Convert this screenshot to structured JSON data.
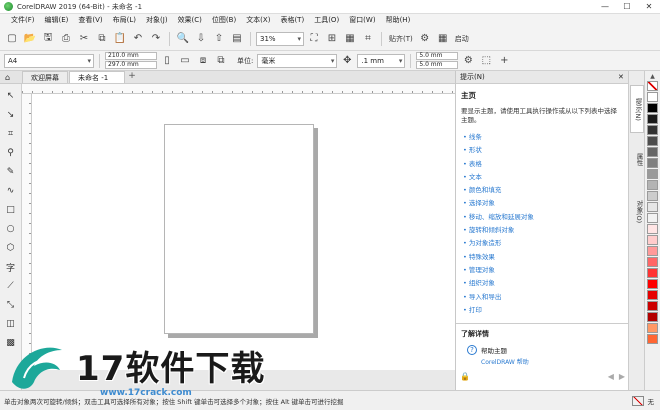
{
  "window": {
    "title": "CorelDRAW 2019 (64-Bit) - 未命名 -1"
  },
  "menu": [
    "文件(F)",
    "编辑(E)",
    "查看(V)",
    "布局(L)",
    "对象(J)",
    "效果(C)",
    "位图(B)",
    "文本(X)",
    "表格(T)",
    "工具(O)",
    "窗口(W)",
    "帮助(H)"
  ],
  "toolbar": {
    "zoom": "31%",
    "snap_label": "贴齐(T)",
    "launch_label": "启动"
  },
  "propbar": {
    "page_size": "A4",
    "width": "210.0 mm",
    "height": "297.0 mm",
    "unit_label": "单位:",
    "unit": "毫米",
    "nudge": ".1 mm",
    "dup_x": "5.0 mm",
    "dup_y": "5.0 mm"
  },
  "tabs": [
    "欢迎屏幕",
    "未命名 -1"
  ],
  "hints": {
    "header": "提示(N)",
    "section": "主页",
    "description": "要显示主题，请使用工具执行操作或从以下列表中选择主题。",
    "links": [
      "线条",
      "形状",
      "表格",
      "文本",
      "颜色和填充",
      "选择对象",
      "移动、缩放和延展对象",
      "旋转和倾斜对象",
      "为对象造形",
      "特殊效果",
      "管理对象",
      "组织对象",
      "导入和导出",
      "打印"
    ],
    "learn_more_title": "了解详情",
    "help_topic_title": "帮助主题",
    "help_topic_link": "CorelDRAW 帮助"
  },
  "side_tabs": [
    "提示(N)",
    "属性",
    "对象(O)"
  ],
  "status": {
    "text": "单击对象两次可旋转/倾斜；双击工具可选择所有对象；按住 Shift 键单击可选择多个对象；按住 Alt 键单击可进行挖掘",
    "fill_label": "无"
  },
  "palette": {
    "colors": [
      "#ffffff",
      "#000000",
      "#1a1a1a",
      "#333333",
      "#4d4d4d",
      "#666666",
      "#808080",
      "#999999",
      "#b3b3b3",
      "#cccccc",
      "#e6e6e6",
      "#f2f2f2",
      "#ffe5e5",
      "#ffcccc",
      "#ff9999",
      "#ff6666",
      "#ff3333",
      "#ff0000",
      "#e60000",
      "#cc0000",
      "#b30000",
      "#ff9966",
      "#ff6633"
    ]
  },
  "watermark": {
    "text": "17软件下载",
    "url": "www.17crack.com"
  }
}
